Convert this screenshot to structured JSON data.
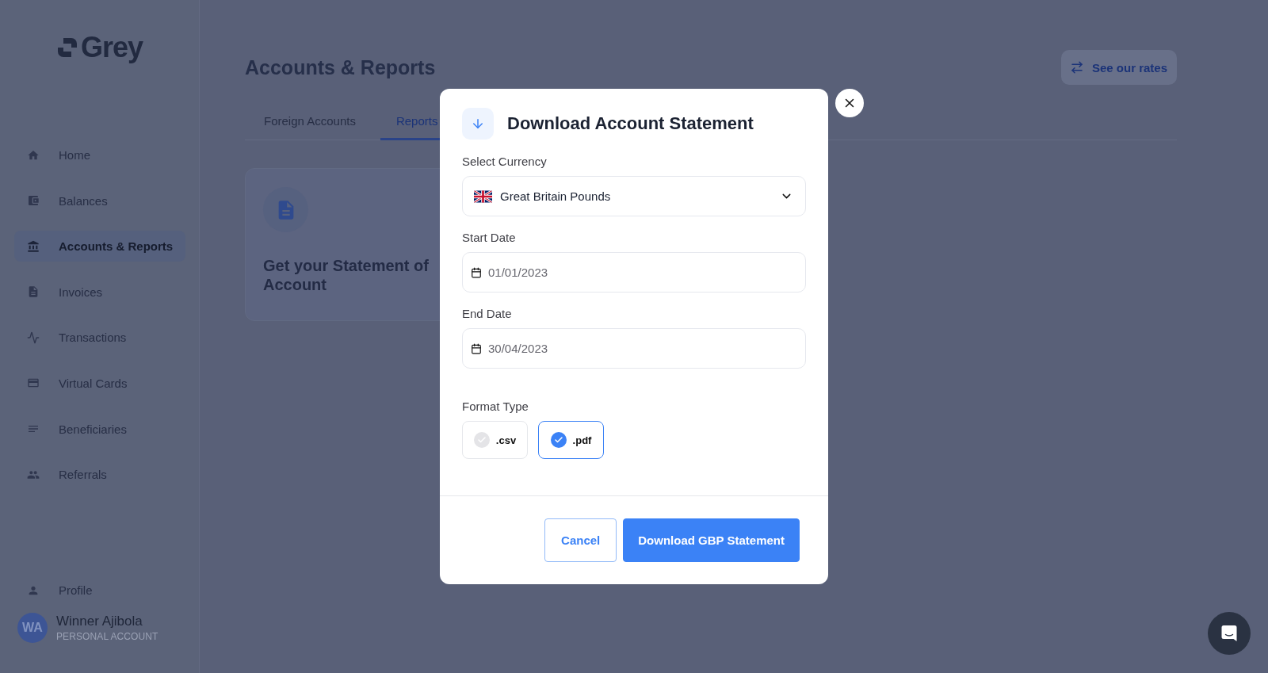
{
  "sidebar": {
    "logo": "Grey",
    "items": [
      {
        "label": "Home",
        "selected": false
      },
      {
        "label": "Balances",
        "selected": false
      },
      {
        "label": "Accounts & Reports",
        "selected": true
      },
      {
        "label": "Invoices",
        "selected": false
      },
      {
        "label": "Transactions",
        "selected": false
      },
      {
        "label": "Virtual Cards",
        "selected": false
      },
      {
        "label": "Beneficiaries",
        "selected": false
      },
      {
        "label": "Referrals",
        "selected": false
      }
    ],
    "bottom_items": [
      {
        "label": "Profile",
        "selected": false
      }
    ],
    "user": {
      "initials": "WA",
      "name": "Winner Ajibola",
      "account_type": "PERSONAL ACCOUNT"
    }
  },
  "header": {
    "title": "Accounts & Reports",
    "rates_button": "See our rates"
  },
  "tabs": [
    {
      "label": "Foreign Accounts",
      "selected": false
    },
    {
      "label": "Reports",
      "selected": true
    }
  ],
  "card": {
    "title": "Get your Statement of Account"
  },
  "modal": {
    "title": "Download Account Statement",
    "fields": [
      {
        "kind": "select",
        "label": "Select Currency",
        "value": "Great Britain Pounds"
      },
      {
        "kind": "date",
        "label": "Start Date",
        "value": "01/01/2023"
      },
      {
        "kind": "date",
        "label": "End Date",
        "value": "30/04/2023"
      }
    ],
    "format": {
      "label": "Format Type",
      "options": [
        {
          "label": ".csv",
          "selected": false
        },
        {
          "label": ".pdf",
          "selected": true
        }
      ]
    },
    "buttons": [
      {
        "kind": "secondary",
        "label": "Cancel"
      },
      {
        "kind": "primary",
        "label": "Download GBP Statement"
      }
    ]
  }
}
